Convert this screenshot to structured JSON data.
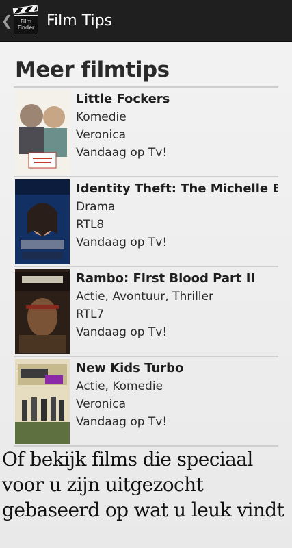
{
  "actionbar": {
    "title": "Film Tips",
    "icon_line1": "Film",
    "icon_line2": "Finder"
  },
  "section_title": "Meer filmtips",
  "movies": [
    {
      "title": "Little Fockers",
      "genre": "Komedie",
      "channel": "Veronica",
      "when": "Vandaag op Tv!",
      "poster_colors": [
        "#f2eee6",
        "#b63a2e"
      ]
    },
    {
      "title": "Identity Theft: The Michelle Brown Story",
      "genre": "Drama",
      "channel": "RTL8",
      "when": "Vandaag op Tv!",
      "poster_colors": [
        "#1f3f7a",
        "#0e1d3a"
      ]
    },
    {
      "title": "Rambo: First Blood Part II",
      "genre": "Actie, Avontuur, Thriller",
      "channel": "RTL7",
      "when": "Vandaag op Tv!",
      "poster_colors": [
        "#3a2a1e",
        "#7b5a3a"
      ]
    },
    {
      "title": "New Kids Turbo",
      "genre": "Actie, Komedie",
      "channel": "Veronica",
      "when": "Vandaag op Tv!",
      "poster_colors": [
        "#d9d2b6",
        "#5b6b3a"
      ]
    }
  ],
  "footer_lines": [
    "Of bekijk films die speciaal",
    "voor u zijn uitgezocht",
    "gebaseerd op wat u leuk vindt"
  ]
}
